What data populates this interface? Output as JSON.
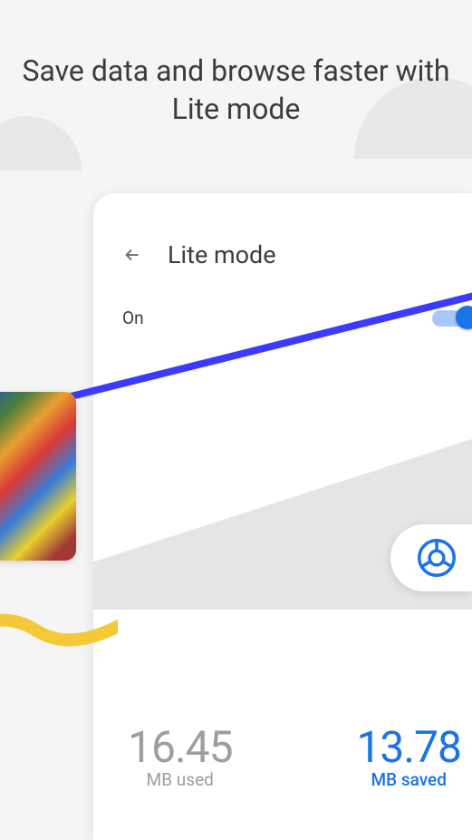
{
  "headline": "Save data and browse faster with Lite mode",
  "card": {
    "title": "Lite mode",
    "toggle": {
      "label": "On",
      "state": true
    }
  },
  "stats": {
    "used": {
      "value": "16.45",
      "label": "MB used"
    },
    "saved": {
      "value": "13.78",
      "label": "MB saved"
    }
  },
  "colors": {
    "accent": "#1a73e8",
    "diagonal": "#3b3bff"
  }
}
